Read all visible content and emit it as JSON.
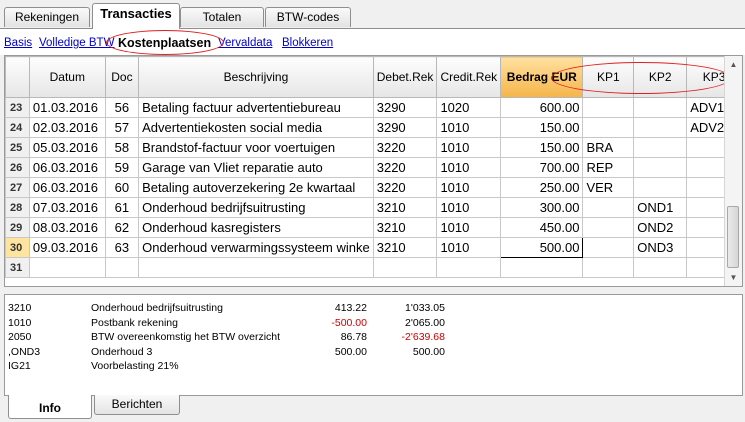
{
  "top_tabs": [
    "Rekeningen",
    "Transacties",
    "Totalen",
    "BTW-codes"
  ],
  "active_top_tab": "Transacties",
  "view_links": [
    "Basis",
    "Volledige BTW",
    "Kostenplaatsen",
    "Vervaldata",
    "Blokkeren"
  ],
  "active_view": "Kostenplaatsen",
  "table": {
    "headers": [
      "",
      "Datum",
      "Doc",
      "Beschrijving",
      "Debet.Rek",
      "Credit.Rek",
      "Bedrag EUR",
      "KP1",
      "KP2",
      "KP3"
    ],
    "rows": [
      {
        "rn": "23",
        "date": "01.03.2016",
        "doc": "56",
        "desc": "Betaling factuur advertentiebureau",
        "debit": "3290",
        "credit": "1020",
        "amount": "600.00",
        "kp1": "",
        "kp2": "",
        "kp3": "ADV1"
      },
      {
        "rn": "24",
        "date": "02.03.2016",
        "doc": "57",
        "desc": "Advertentiekosten social media",
        "debit": "3290",
        "credit": "1010",
        "amount": "150.00",
        "kp1": "",
        "kp2": "",
        "kp3": "ADV2"
      },
      {
        "rn": "25",
        "date": "05.03.2016",
        "doc": "58",
        "desc": "Brandstof-factuur voor voertuigen",
        "debit": "3220",
        "credit": "1010",
        "amount": "150.00",
        "kp1": "BRA",
        "kp2": "",
        "kp3": ""
      },
      {
        "rn": "26",
        "date": "06.03.2016",
        "doc": "59",
        "desc": "Garage van Vliet reparatie auto",
        "debit": "3220",
        "credit": "1010",
        "amount": "700.00",
        "kp1": "REP",
        "kp2": "",
        "kp3": ""
      },
      {
        "rn": "27",
        "date": "06.03.2016",
        "doc": "60",
        "desc": "Betaling autoverzekering 2e kwartaal",
        "debit": "3220",
        "credit": "1010",
        "amount": "250.00",
        "kp1": "VER",
        "kp2": "",
        "kp3": ""
      },
      {
        "rn": "28",
        "date": "07.03.2016",
        "doc": "61",
        "desc": "Onderhoud bedrijfsuitrusting",
        "debit": "3210",
        "credit": "1010",
        "amount": "300.00",
        "kp1": "",
        "kp2": "OND1",
        "kp3": ""
      },
      {
        "rn": "29",
        "date": "08.03.2016",
        "doc": "62",
        "desc": "Onderhoud kasregisters",
        "debit": "3210",
        "credit": "1010",
        "amount": "450.00",
        "kp1": "",
        "kp2": "OND2",
        "kp3": ""
      },
      {
        "rn": "30",
        "date": "09.03.2016",
        "doc": "63",
        "desc": "Onderhoud verwarmingssysteem winke",
        "debit": "3210",
        "credit": "1010",
        "amount": "500.00",
        "kp1": "",
        "kp2": "OND3",
        "kp3": ""
      },
      {
        "rn": "31",
        "date": "",
        "doc": "",
        "desc": "",
        "debit": "",
        "credit": "",
        "amount": "",
        "kp1": "",
        "kp2": "",
        "kp3": ""
      }
    ],
    "current_row": "30"
  },
  "info": [
    {
      "code": "3210",
      "desc": "Onderhoud bedrijfsuitrusting",
      "v1": "413.22",
      "v2": "1'033.05",
      "v1_neg": false,
      "v2_neg": false
    },
    {
      "code": "1010",
      "desc": "Postbank rekening",
      "v1": "-500.00",
      "v2": "2'065.00",
      "v1_neg": true,
      "v2_neg": false
    },
    {
      "code": "2050",
      "desc": "BTW overeenkomstig het BTW overzicht",
      "v1": "86.78",
      "v2": "-2'639.68",
      "v1_neg": false,
      "v2_neg": true
    },
    {
      "code": ",OND3",
      "desc": "Onderhoud 3",
      "v1": "500.00",
      "v2": "500.00",
      "v1_neg": false,
      "v2_neg": false
    },
    {
      "code": "IG21",
      "desc": "Voorbelasting 21%",
      "v1": "",
      "v2": "",
      "v1_neg": false,
      "v2_neg": false
    }
  ],
  "bottom_tabs": [
    "Info",
    "Berichten"
  ],
  "active_bottom_tab": "Info",
  "colors": {
    "link": "#0000cc",
    "highlight_oval": "#e02020",
    "amount_header": "#f5b54a",
    "negative": "#cc0000"
  }
}
